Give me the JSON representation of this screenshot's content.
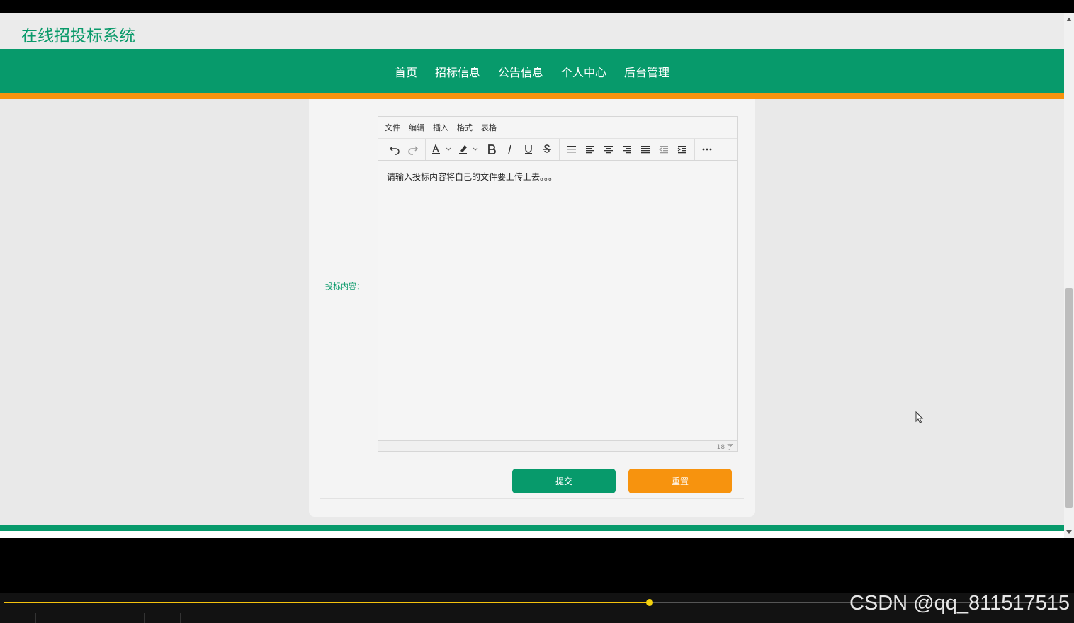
{
  "site": {
    "title": "在线招投标系统"
  },
  "nav": {
    "items": [
      "首页",
      "招标信息",
      "公告信息",
      "个人中心",
      "后台管理"
    ]
  },
  "form": {
    "content_label": "投标内容：",
    "submit_label": "提交",
    "reset_label": "重置"
  },
  "editor": {
    "menus": [
      "文件",
      "编辑",
      "插入",
      "格式",
      "表格"
    ],
    "content_text": "请输入投标内容将自己的文件要上传上去。。。",
    "word_count": "18 字"
  },
  "video": {
    "progress_fraction": 0.61
  },
  "watermark": "CSDN @qq_811517515",
  "colors": {
    "primary": "#079a6b",
    "accent": "#f7930e",
    "title": "#0a9a6a"
  }
}
